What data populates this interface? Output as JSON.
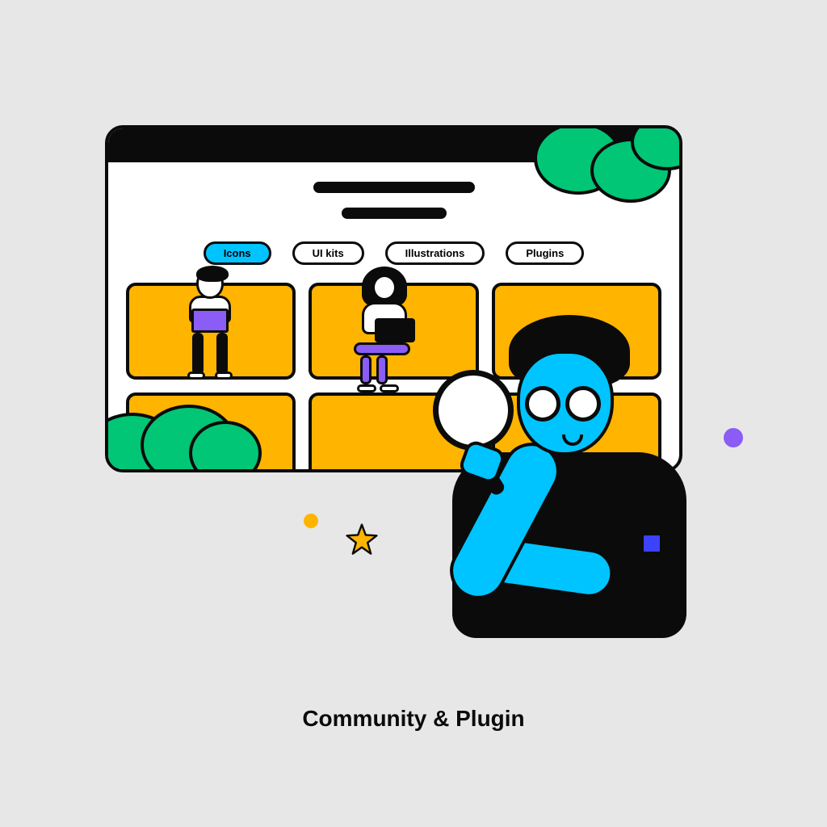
{
  "tabs": {
    "active_index": 0,
    "items": [
      "Icons",
      "UI kits",
      "Illustrations",
      "Plugins"
    ]
  },
  "caption": "Community & Plugin",
  "colors": {
    "accent_cyan": "#00c4ff",
    "accent_yellow": "#ffb400",
    "accent_green": "#00c676",
    "accent_purple": "#8b5cf6",
    "accent_blue": "#3b43ff",
    "stroke": "#0b0b0b",
    "bg": "#e7e7e7"
  },
  "icons": {
    "magnifier": "magnifier-icon",
    "star": "star-icon",
    "cloud": "cloud-icon",
    "bush": "bush-icon"
  }
}
